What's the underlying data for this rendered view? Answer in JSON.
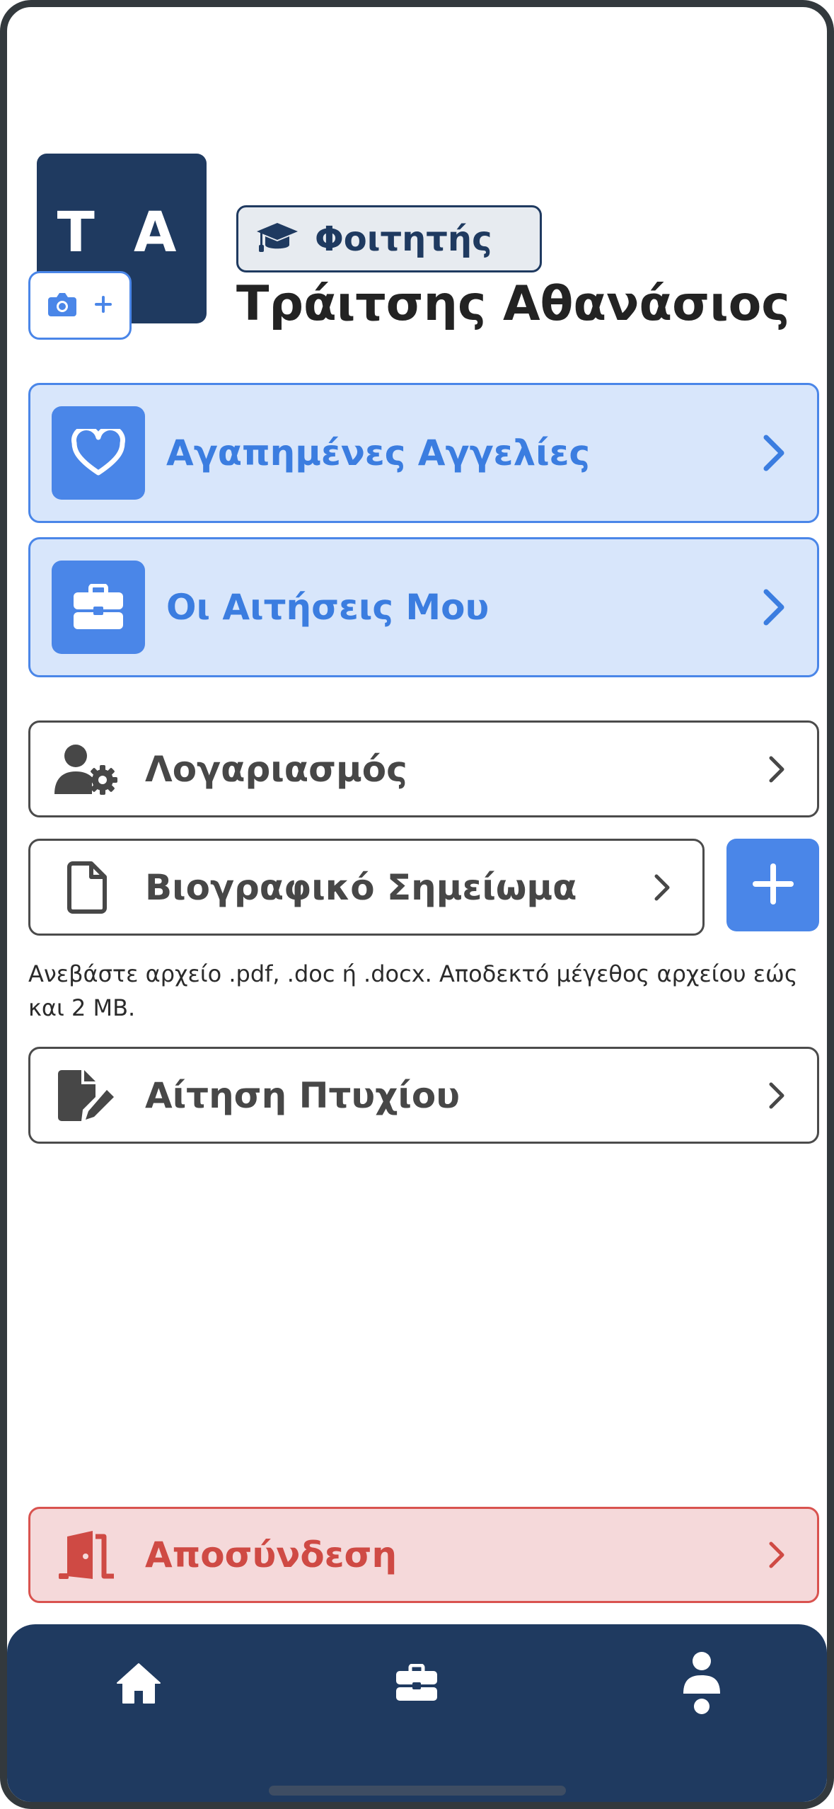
{
  "profile": {
    "initials": "T A",
    "role": "Φοιτητής",
    "name": "Τράιτσης Αθανάσιος"
  },
  "menu": {
    "favorites_label": "Αγαπημένες Αγγελίες",
    "applications_label": "Οι Αιτήσεις Μου",
    "account_label": "Λογαριασμός",
    "cv_label": "Βιογραφικό Σημείωμα",
    "cv_note": "Ανεβάστε αρχείο .pdf, .doc ή .docx. Αποδεκτό μέγεθος αρχείου εώς και 2 MB.",
    "degree_label": "Αίτηση Πτυχίου",
    "logout_label": "Αποσύνδεση"
  },
  "colors": {
    "navy": "#1f3a60",
    "accent_blue": "#4a86e8",
    "danger_red": "#d9534f"
  },
  "icons": {
    "photo_add": "camera-plus-icon",
    "role": "graduation-cap-icon",
    "favorites": "heart-icon",
    "applications": "briefcase-icon",
    "account": "user-gear-icon",
    "cv": "file-icon",
    "degree": "file-pen-icon",
    "logout": "door-open-icon",
    "nav": [
      "home-icon",
      "briefcase-icon",
      "user-icon"
    ]
  }
}
